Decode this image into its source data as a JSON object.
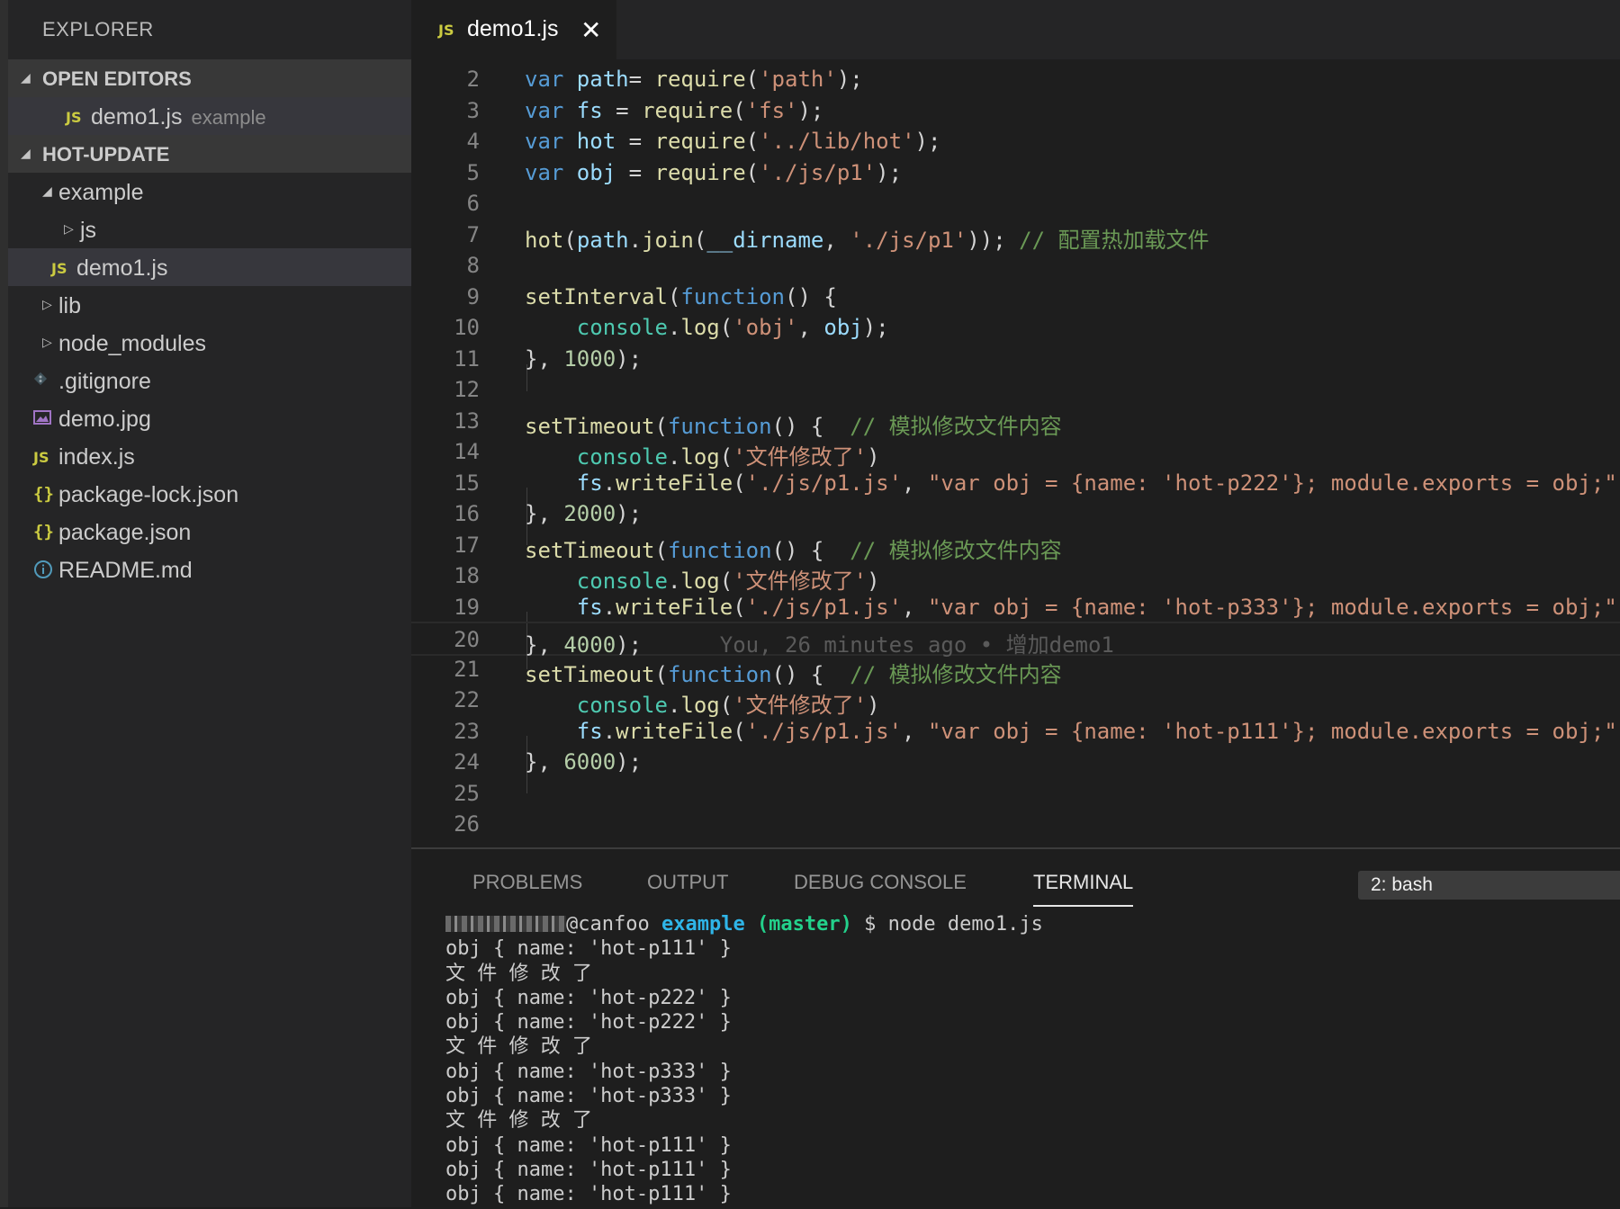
{
  "sidebar": {
    "title": "EXPLORER",
    "open_editors_label": "OPEN EDITORS",
    "open_editor": {
      "icon": "JS",
      "name": "demo1.js",
      "folder": "example"
    },
    "project_label": "HOT-UPDATE",
    "tree": [
      {
        "type": "folder",
        "name": "example"
      },
      {
        "type": "folder",
        "name": "js"
      },
      {
        "type": "js",
        "icon": "JS",
        "name": "demo1.js"
      },
      {
        "type": "folder",
        "name": "lib"
      },
      {
        "type": "folder",
        "name": "node_modules"
      },
      {
        "type": "git",
        "name": ".gitignore"
      },
      {
        "type": "image",
        "name": "demo.jpg"
      },
      {
        "type": "js",
        "icon": "JS",
        "name": "index.js"
      },
      {
        "type": "json",
        "icon": "{}",
        "name": "package-lock.json"
      },
      {
        "type": "json",
        "icon": "{}",
        "name": "package.json"
      },
      {
        "type": "info",
        "name": "README.md"
      }
    ]
  },
  "tab": {
    "icon": "JS",
    "name": "demo1.js",
    "close": "✕"
  },
  "editor": {
    "lines": [
      {
        "n": "2",
        "t": [
          [
            "k",
            "var "
          ],
          [
            "v",
            "path"
          ],
          [
            "",
            "= "
          ],
          [
            "f",
            "require"
          ],
          [
            "",
            "("
          ],
          [
            "s",
            "'path'"
          ],
          [
            "",
            ");"
          ]
        ]
      },
      {
        "n": "3",
        "t": [
          [
            "k",
            "var "
          ],
          [
            "v",
            "fs"
          ],
          [
            "",
            " = "
          ],
          [
            "f",
            "require"
          ],
          [
            "",
            "("
          ],
          [
            "s",
            "'fs'"
          ],
          [
            "",
            ");"
          ]
        ]
      },
      {
        "n": "4",
        "t": [
          [
            "k",
            "var "
          ],
          [
            "v",
            "hot"
          ],
          [
            "",
            " = "
          ],
          [
            "f",
            "require"
          ],
          [
            "",
            "("
          ],
          [
            "s",
            "'../lib/hot'"
          ],
          [
            "",
            ");"
          ]
        ]
      },
      {
        "n": "5",
        "t": [
          [
            "k",
            "var "
          ],
          [
            "v",
            "obj"
          ],
          [
            "",
            " = "
          ],
          [
            "f",
            "require"
          ],
          [
            "",
            "("
          ],
          [
            "s",
            "'./js/p1'"
          ],
          [
            "",
            ");"
          ]
        ]
      },
      {
        "n": "6",
        "t": []
      },
      {
        "n": "7",
        "t": [
          [
            "f",
            "hot"
          ],
          [
            "",
            "("
          ],
          [
            "v",
            "path"
          ],
          [
            "",
            "."
          ],
          [
            "f",
            "join"
          ],
          [
            "",
            "("
          ],
          [
            "v",
            "__dirname"
          ],
          [
            "",
            ", "
          ],
          [
            "s",
            "'./js/p1'"
          ],
          [
            "",
            "));"
          ],
          [
            "",
            " "
          ],
          [
            "c",
            "// 配置热加载文件"
          ]
        ]
      },
      {
        "n": "8",
        "t": []
      },
      {
        "n": "9",
        "t": [
          [
            "f",
            "setInterval"
          ],
          [
            "",
            "("
          ],
          [
            "k",
            "function"
          ],
          [
            "",
            "() {"
          ]
        ]
      },
      {
        "n": "10",
        "t": [
          [
            "",
            "    "
          ],
          [
            "g",
            "console"
          ],
          [
            "",
            "."
          ],
          [
            "f",
            "log"
          ],
          [
            "",
            "("
          ],
          [
            "s",
            "'obj'"
          ],
          [
            "",
            ", "
          ],
          [
            "v",
            "obj"
          ],
          [
            "",
            ");"
          ]
        ]
      },
      {
        "n": "11",
        "t": [
          [
            "",
            "}, "
          ],
          [
            "n",
            "1000"
          ],
          [
            "",
            ");"
          ]
        ]
      },
      {
        "n": "12",
        "t": []
      },
      {
        "n": "13",
        "t": [
          [
            "f",
            "setTimeout"
          ],
          [
            "",
            "("
          ],
          [
            "k",
            "function"
          ],
          [
            "",
            "() {  "
          ],
          [
            "c",
            "// 模拟修改文件内容"
          ]
        ]
      },
      {
        "n": "14",
        "t": [
          [
            "",
            "    "
          ],
          [
            "g",
            "console"
          ],
          [
            "",
            "."
          ],
          [
            "f",
            "log"
          ],
          [
            "",
            "("
          ],
          [
            "s",
            "'文件修改了'"
          ],
          [
            "",
            ")"
          ]
        ]
      },
      {
        "n": "15",
        "t": [
          [
            "",
            "    "
          ],
          [
            "v",
            "fs"
          ],
          [
            "",
            "."
          ],
          [
            "f",
            "writeFile"
          ],
          [
            "",
            "("
          ],
          [
            "s",
            "'./js/p1.js'"
          ],
          [
            "",
            ", "
          ],
          [
            "s",
            "\"var obj = {name: 'hot-p222'}; module.exports = obj;\""
          ],
          [
            "",
            ");"
          ]
        ]
      },
      {
        "n": "16",
        "t": [
          [
            "",
            "}, "
          ],
          [
            "n",
            "2000"
          ],
          [
            "",
            ");"
          ]
        ]
      },
      {
        "n": "17",
        "t": [
          [
            "f",
            "setTimeout"
          ],
          [
            "",
            "("
          ],
          [
            "k",
            "function"
          ],
          [
            "",
            "() {  "
          ],
          [
            "c",
            "// 模拟修改文件内容"
          ]
        ]
      },
      {
        "n": "18",
        "t": [
          [
            "",
            "    "
          ],
          [
            "g",
            "console"
          ],
          [
            "",
            "."
          ],
          [
            "f",
            "log"
          ],
          [
            "",
            "("
          ],
          [
            "s",
            "'文件修改了'"
          ],
          [
            "",
            ")"
          ]
        ]
      },
      {
        "n": "19",
        "t": [
          [
            "",
            "    "
          ],
          [
            "v",
            "fs"
          ],
          [
            "",
            "."
          ],
          [
            "f",
            "writeFile"
          ],
          [
            "",
            "("
          ],
          [
            "s",
            "'./js/p1.js'"
          ],
          [
            "",
            ", "
          ],
          [
            "s",
            "\"var obj = {name: 'hot-p333'}; module.exports = obj;\""
          ],
          [
            "",
            ");"
          ]
        ]
      },
      {
        "n": "20",
        "t": [
          [
            "",
            "}, "
          ],
          [
            "n",
            "4000"
          ],
          [
            "",
            ");"
          ],
          [
            "blame",
            "      You, 26 minutes ago • 增加demo1"
          ]
        ]
      },
      {
        "n": "21",
        "t": [
          [
            "f",
            "setTimeout"
          ],
          [
            "",
            "("
          ],
          [
            "k",
            "function"
          ],
          [
            "",
            "() {  "
          ],
          [
            "c",
            "// 模拟修改文件内容"
          ]
        ]
      },
      {
        "n": "22",
        "t": [
          [
            "",
            "    "
          ],
          [
            "g",
            "console"
          ],
          [
            "",
            "."
          ],
          [
            "f",
            "log"
          ],
          [
            "",
            "("
          ],
          [
            "s",
            "'文件修改了'"
          ],
          [
            "",
            ")"
          ]
        ]
      },
      {
        "n": "23",
        "t": [
          [
            "",
            "    "
          ],
          [
            "v",
            "fs"
          ],
          [
            "",
            "."
          ],
          [
            "f",
            "writeFile"
          ],
          [
            "",
            "("
          ],
          [
            "s",
            "'./js/p1.js'"
          ],
          [
            "",
            ", "
          ],
          [
            "s",
            "\"var obj = {name: 'hot-p111'}; module.exports = obj;\""
          ],
          [
            "",
            ");"
          ]
        ]
      },
      {
        "n": "24",
        "t": [
          [
            "",
            "}, "
          ],
          [
            "n",
            "6000"
          ],
          [
            "",
            ");"
          ]
        ]
      },
      {
        "n": "25",
        "t": []
      },
      {
        "n": "26",
        "t": []
      }
    ]
  },
  "panel": {
    "tabs": [
      "PROBLEMS",
      "OUTPUT",
      "DEBUG CONSOLE",
      "TERMINAL"
    ],
    "active_tab": "TERMINAL",
    "terminal_select": "2: bash",
    "prompt": {
      "host": "@canfoo ",
      "dir": "example",
      "branch": "(master)",
      "cmd": " $ node demo1.js"
    },
    "output": [
      "obj { name: 'hot-p111' }",
      "文 件 修 改 了",
      "obj { name: 'hot-p222' }",
      "obj { name: 'hot-p222' }",
      "文 件 修 改 了",
      "obj { name: 'hot-p333' }",
      "obj { name: 'hot-p333' }",
      "文 件 修 改 了",
      "obj { name: 'hot-p111' }",
      "obj { name: 'hot-p111' }",
      "obj { name: 'hot-p111' }"
    ]
  }
}
